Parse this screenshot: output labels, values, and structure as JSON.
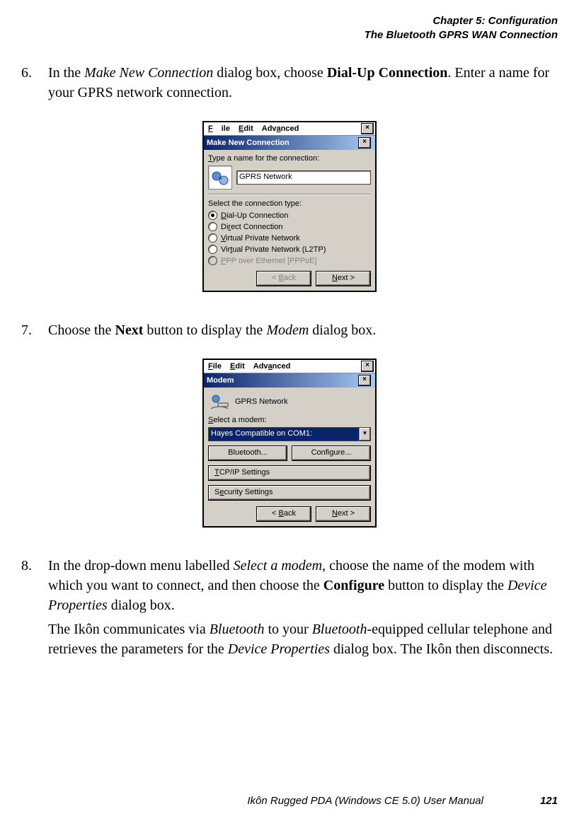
{
  "header": {
    "chapter": "Chapter 5:  Configuration",
    "section": "The Bluetooth GPRS WAN Connection"
  },
  "steps": {
    "n6": "6.",
    "p6a": "In the ",
    "p6b": "Make New Connection",
    "p6c": " dialog box, choose ",
    "p6d": "Dial-Up Connection",
    "p6e": ". Enter a name for your GPRS network connection.",
    "n7": "7.",
    "p7a": "Choose the ",
    "p7b": "Next",
    "p7c": " button to display the ",
    "p7d": "Modem",
    "p7e": " dialog box.",
    "n8": "8.",
    "p8a": "In the drop-down menu labelled ",
    "p8b": "Select a modem",
    "p8c": ", choose the name of the modem with which you want to connect, and then choose the ",
    "p8d": "Configure",
    "p8e": " button to display the ",
    "p8f": "Device Properties",
    "p8g": " dialog box.",
    "p8h1": "The Ikôn communicates via ",
    "p8h2": "Bluetooth",
    "p8h3": " to your ",
    "p8h4": "Bluetooth",
    "p8h5": "-equipped cellular telephone and retrieves the parameters for the ",
    "p8h6": "Device Properties",
    "p8h7": " dialog box. The Ikôn then disconnects."
  },
  "dialog1": {
    "menu": {
      "file": "File",
      "edit": "Edit",
      "adv": "Advanced",
      "x": "×"
    },
    "title": "Make New Connection",
    "x": "×",
    "typeLabel": "Type a name for the connection:",
    "nameValue": "GPRS Network",
    "selectLabel": "Select the connection type:",
    "opts": {
      "dial": "Dial-Up Connection",
      "direct": "Direct Connection",
      "vpn": "Virtual Private Network",
      "l2tp": "Virtual Private Network (L2TP)",
      "pppoe": "PPP over Ethernet [PPPoE]"
    },
    "back": "< Back",
    "next": "Next >"
  },
  "dialog2": {
    "menu": {
      "file": "File",
      "edit": "Edit",
      "adv": "Advanced",
      "x": "×"
    },
    "title": "Modem",
    "x": "×",
    "name": "GPRS Network",
    "selectLabel": "Select a modem:",
    "modem": "Hayes Compatible on COM1:",
    "bt": "Bluetooth...",
    "conf": "Configure...",
    "tcp": "TCP/IP Settings",
    "sec": "Security Settings",
    "back": "< Back",
    "next": "Next >"
  },
  "footer": {
    "manual": "Ikôn Rugged PDA (Windows CE 5.0) User Manual",
    "page": "121"
  }
}
